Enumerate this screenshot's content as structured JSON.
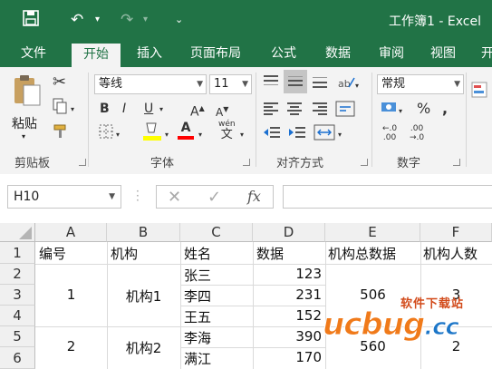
{
  "window": {
    "title": "工作簿1 - Excel"
  },
  "tabs": [
    {
      "label": "文件"
    },
    {
      "label": "开始"
    },
    {
      "label": "插入"
    },
    {
      "label": "页面布局"
    },
    {
      "label": "公式"
    },
    {
      "label": "数据"
    },
    {
      "label": "审阅"
    },
    {
      "label": "视图"
    },
    {
      "label": "开"
    }
  ],
  "ribbon": {
    "clipboard": {
      "paste_label": "粘贴",
      "group_label": "剪贴板"
    },
    "font": {
      "font_name": "等线",
      "font_size": "11",
      "group_label": "字体",
      "wen_label": "wén"
    },
    "alignment": {
      "group_label": "对齐方式"
    },
    "number": {
      "format": "常规",
      "group_label": "数字"
    }
  },
  "formula_bar": {
    "name_box": "H10",
    "fx": "fx",
    "value": ""
  },
  "columns": [
    "A",
    "B",
    "C",
    "D",
    "E",
    "F"
  ],
  "rows": [
    "1",
    "2",
    "3",
    "4",
    "5",
    "6"
  ],
  "cells": {
    "header": [
      "编号",
      "机构",
      "姓名",
      "数据",
      "机构总数据",
      "机构人数"
    ],
    "names": [
      "张三",
      "李四",
      "王五",
      "李海",
      "满江"
    ],
    "values": [
      "123",
      "231",
      "152",
      "390",
      "170"
    ],
    "group1": {
      "id": "1",
      "org": "机构1",
      "total": "506",
      "count": "3"
    },
    "group2": {
      "id": "2",
      "org": "机构2",
      "total": "560",
      "count": "2"
    }
  },
  "watermark": {
    "brand": "ucbug",
    "suffix": ".cc",
    "tagline": "软件下载站"
  },
  "colors": {
    "excel_green": "#217346",
    "highlight_yellow": "#ffff00",
    "font_red": "#ff0000"
  }
}
